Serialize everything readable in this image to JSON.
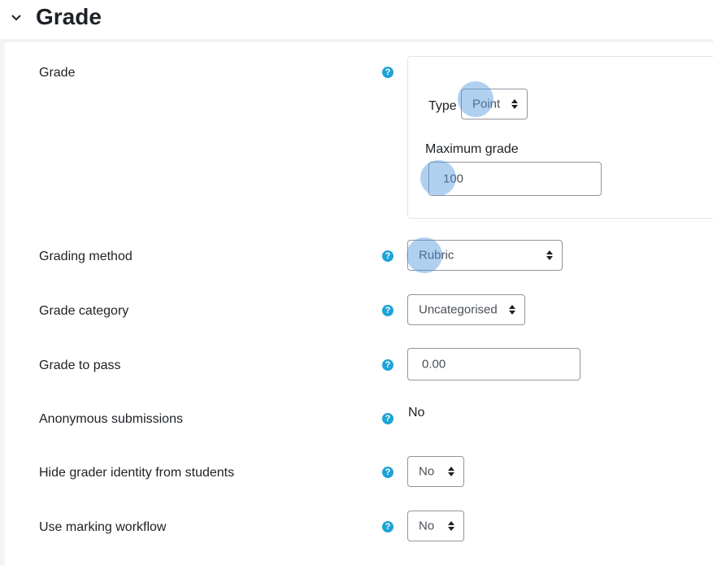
{
  "section": {
    "title": "Grade"
  },
  "grade": {
    "label": "Grade",
    "type_label": "Type",
    "type_value": "Point",
    "max_label": "Maximum grade",
    "max_value": "100"
  },
  "grading_method": {
    "label": "Grading method",
    "value": "Rubric"
  },
  "grade_category": {
    "label": "Grade category",
    "value": "Uncategorised"
  },
  "grade_to_pass": {
    "label": "Grade to pass",
    "value": "0.00"
  },
  "anonymous": {
    "label": "Anonymous submissions",
    "value": "No"
  },
  "hide_grader": {
    "label": "Hide grader identity from students",
    "value": "No"
  },
  "marking_workflow": {
    "label": "Use marking workflow",
    "value": "No"
  },
  "help_glyph": "?",
  "colors": {
    "help_icon": "#1fa3d6",
    "click_marker": "#5096dc"
  },
  "icons": {
    "collapse": "chevron-down-icon",
    "help": "help-icon",
    "select": "select-caret-icon"
  }
}
